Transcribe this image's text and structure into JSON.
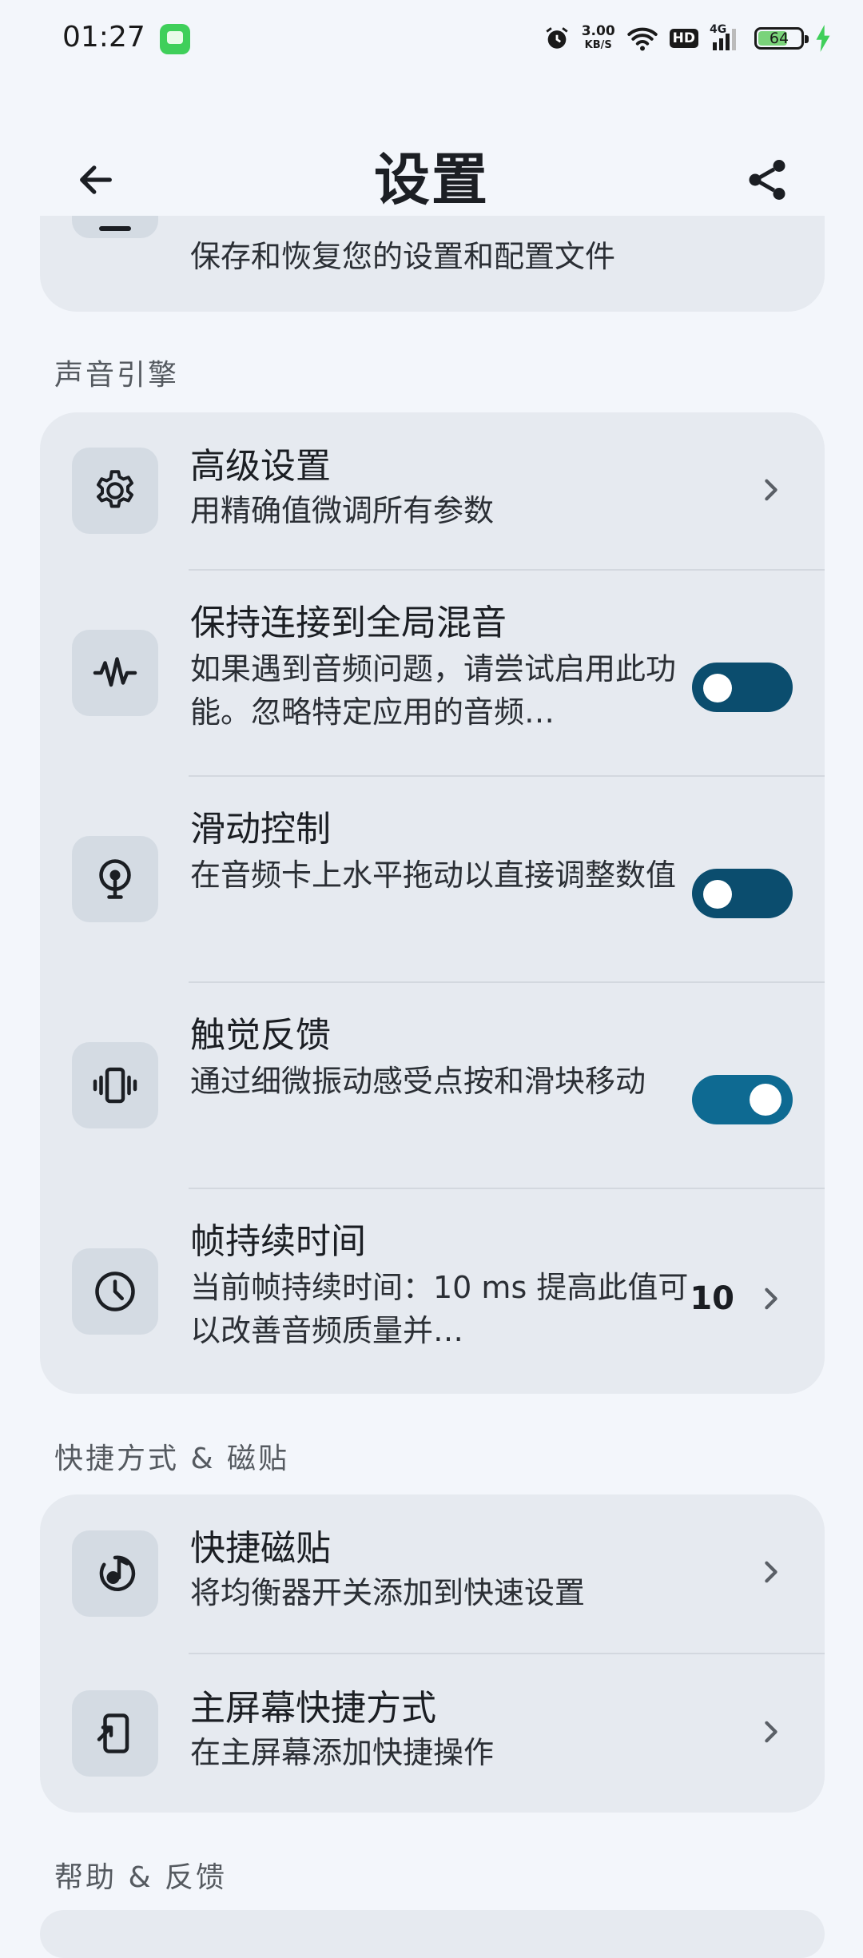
{
  "status_bar": {
    "time": "01:27",
    "network_speed": "3.00",
    "network_speed_unit": "KB/S",
    "hd_badge": "HD",
    "signal_label": "4G",
    "battery": "64",
    "app_icon": "messaging-icon"
  },
  "app_bar": {
    "title": "设置",
    "back_icon": "arrow-back-icon",
    "share_icon": "share-icon"
  },
  "top_card": {
    "subtitle": "保存和恢复您的设置和配置文件"
  },
  "section_audio": {
    "header": "声音引擎",
    "items": [
      {
        "title": "高级设置",
        "subtitle": "用精确值微调所有参数",
        "icon": "gear-icon",
        "control": "chevron"
      },
      {
        "title": "保持连接到全局混音",
        "subtitle": "如果遇到音频问题，请尝试启用此功能。忽略特定应用的音频…",
        "icon": "waveform-icon",
        "control": "toggle",
        "enabled": false
      },
      {
        "title": "滑动控制",
        "subtitle": "在音频卡上水平拖动以直接调整数值",
        "icon": "swipe-icon",
        "control": "toggle",
        "enabled": false
      },
      {
        "title": "触觉反馈",
        "subtitle": "通过细微振动感受点按和滑块移动",
        "icon": "vibration-icon",
        "control": "toggle",
        "enabled": true
      },
      {
        "title": "帧持续时间",
        "subtitle": "当前帧持续时间：10 ms 提高此值可以改善音频质量并…",
        "icon": "clock-icon",
        "control": "value",
        "value": "10"
      }
    ]
  },
  "section_shortcuts": {
    "header": "快捷方式 & 磁贴",
    "items": [
      {
        "title": "快捷磁贴",
        "subtitle": "将均衡器开关添加到快速设置",
        "icon": "music-tile-icon"
      },
      {
        "title": "主屏幕快捷方式",
        "subtitle": "在主屏幕添加快捷操作",
        "icon": "add-to-home-icon"
      }
    ]
  },
  "section_help": {
    "header": "帮助 & 反馈"
  },
  "colors": {
    "background": "#f3f6fb",
    "card": "#e6eaf0",
    "icon_box": "#d4dbe3",
    "toggle_off": "#0b4d6e",
    "toggle_on": "#0e6a92"
  }
}
